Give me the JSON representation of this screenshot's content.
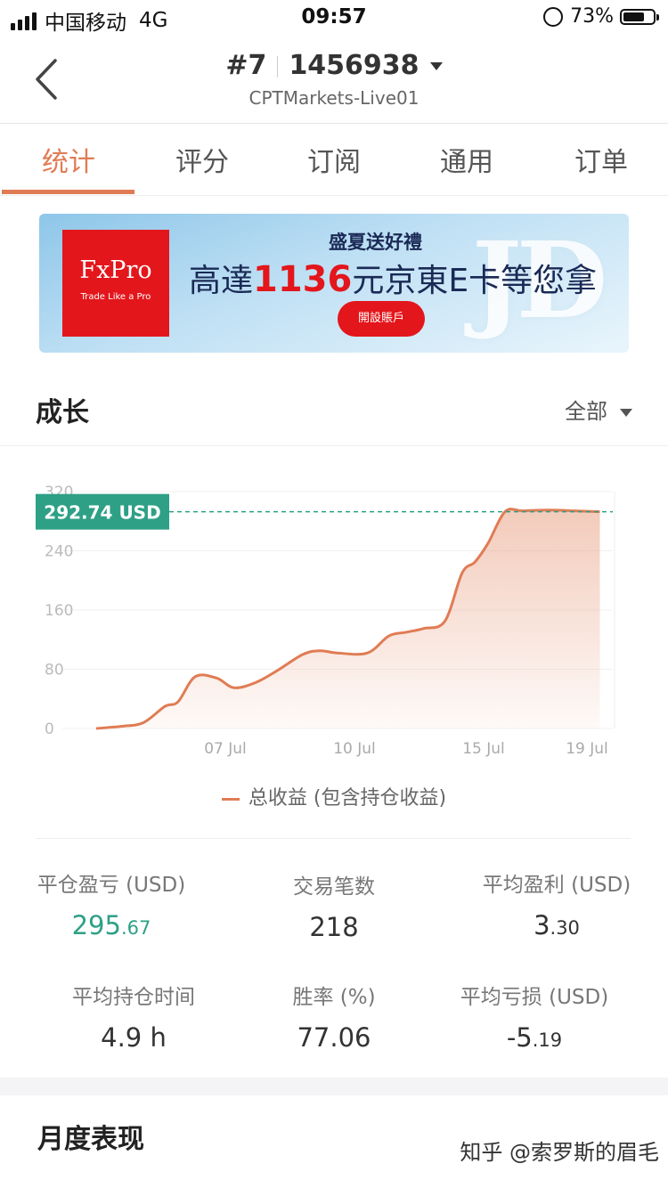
{
  "status_bar": {
    "carrier": "中国移动",
    "network": "4G",
    "time": "09:57",
    "battery": "73%"
  },
  "header": {
    "rank": "#7",
    "account": "1456938",
    "server": "CPTMarkets-Live01"
  },
  "tabs": [
    {
      "label": "统计",
      "active": true
    },
    {
      "label": "评分",
      "active": false
    },
    {
      "label": "订阅",
      "active": false
    },
    {
      "label": "通用",
      "active": false
    },
    {
      "label": "订单",
      "active": false
    }
  ],
  "banner": {
    "logo": "FxPro",
    "tagline": "Trade Like a Pro",
    "title": "盛夏送好禮",
    "main_pre": "高達",
    "main_amount": "1136",
    "main_post": "元京東E卡等您拿",
    "button": "開設賬戶",
    "art": "JD"
  },
  "growth": {
    "title": "成长",
    "filter": "全部"
  },
  "chart_data": {
    "type": "area",
    "current_label": "292.74 USD",
    "current_value": 292.74,
    "y_ticks": [
      "320",
      "240",
      "160",
      "80",
      "0"
    ],
    "ylim": [
      0,
      320
    ],
    "x_ticks": [
      {
        "label": "07 Jul",
        "x": 4
      },
      {
        "label": "10 Jul",
        "x": 7
      },
      {
        "label": "15 Jul",
        "x": 10
      },
      {
        "label": "19 Jul",
        "x": 12.4
      }
    ],
    "xlim": [
      1,
      13
    ],
    "x": [
      1,
      1.6,
      2.1,
      2.6,
      2.9,
      3.3,
      3.8,
      4.2,
      4.7,
      5.2,
      5.8,
      6.2,
      6.6,
      7.3,
      7.8,
      8.2,
      8.6,
      9.1,
      9.5,
      9.8,
      10.1,
      10.5,
      10.9,
      11.5,
      12.1,
      12.7
    ],
    "y": [
      0,
      3,
      8,
      30,
      36,
      70,
      68,
      55,
      62,
      78,
      100,
      105,
      102,
      102,
      125,
      130,
      135,
      145,
      210,
      225,
      250,
      293,
      294,
      295,
      294,
      292.74
    ],
    "grid": true,
    "legend": "总收益 (包含持仓收益)",
    "color": "#e07c54",
    "current_color": "#2ea086"
  },
  "stats": [
    {
      "label": "平仓盈亏 (USD)",
      "int": "295",
      "dec": ".67",
      "positive": true
    },
    {
      "label": "交易笔数",
      "int": "218",
      "dec": ""
    },
    {
      "label": "平均盈利 (USD)",
      "int": "3",
      "dec": ".30"
    },
    {
      "label": "平均持仓时间",
      "int": "4.9 h",
      "dec": ""
    },
    {
      "label": "胜率 (%)",
      "int": "77.06",
      "dec": ""
    },
    {
      "label": "平均亏损 (USD)",
      "int": "-5",
      "dec": ".19"
    }
  ],
  "monthly": {
    "title": "月度表现"
  },
  "watermark": "知乎 @索罗斯的眉毛"
}
